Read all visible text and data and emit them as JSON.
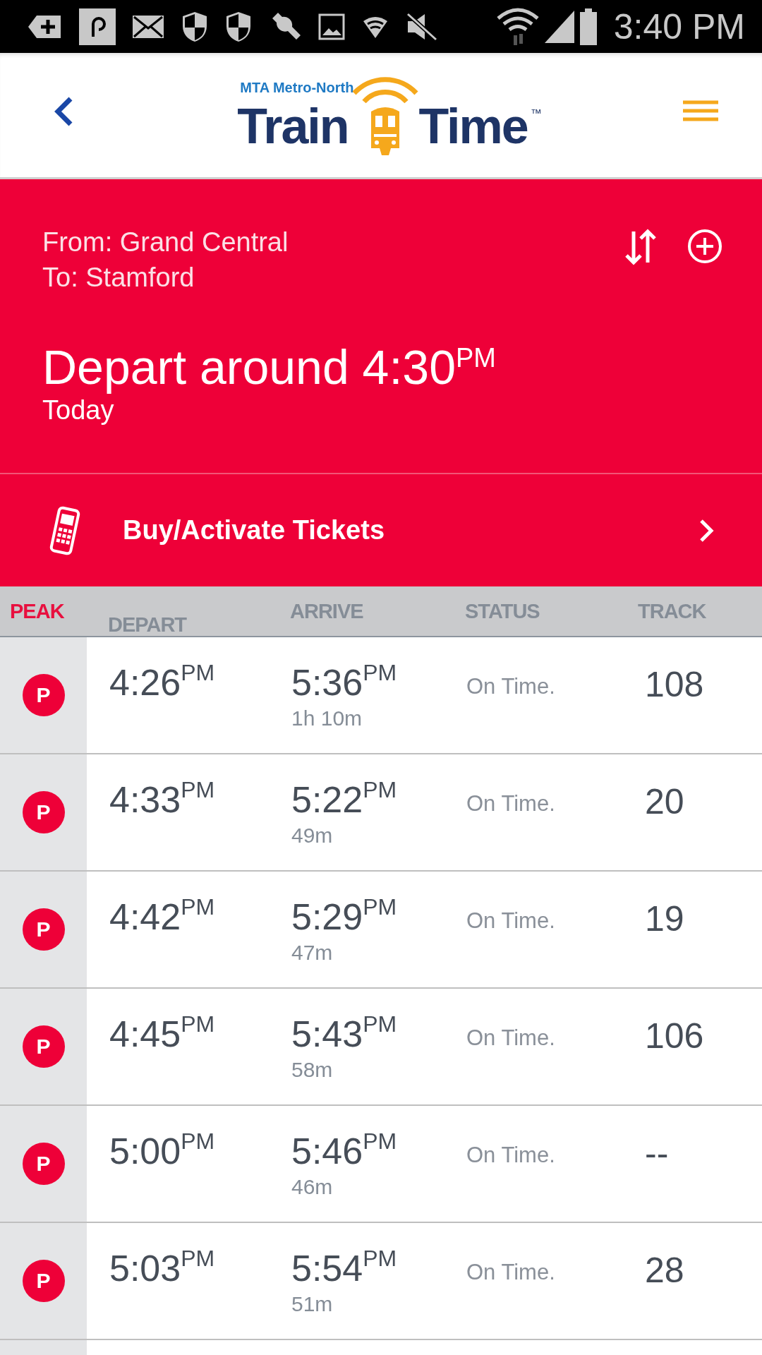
{
  "status_bar": {
    "time": "3:40 PM"
  },
  "header": {
    "brand": "MTA Metro-North",
    "title_left": "Train",
    "title_right": "Time",
    "trademark": "™"
  },
  "trip": {
    "from": "From: Grand Central",
    "to": "To: Stamford",
    "depart": "Depart around 4:30$^{PM}$",
    "day": "Today"
  },
  "tickets": {
    "label": "Buy/Activate Tickets"
  },
  "table": {
    "columns": [
      "PEAK",
      "DEPART",
      "ARRIVE",
      "STATUS",
      "TRACK"
    ],
    "rows": [
      {
        "peak": "P",
        "depart": "4:26$^{PM}$",
        "arrive": "5:36$^{PM}$",
        "duration": "1h 10m",
        "status": "On Time.",
        "track": "108"
      },
      {
        "peak": "P",
        "depart": "4:33$^{PM}$",
        "arrive": "5:22$^{PM}$",
        "duration": "49m",
        "status": "On Time.",
        "track": "20"
      },
      {
        "peak": "P",
        "depart": "4:42$^{PM}$",
        "arrive": "5:29$^{PM}$",
        "duration": "47m",
        "status": "On Time.",
        "track": "19"
      },
      {
        "peak": "P",
        "depart": "4:45$^{PM}$",
        "arrive": "5:43$^{PM}$",
        "duration": "58m",
        "status": "On Time.",
        "track": "106"
      },
      {
        "peak": "P",
        "depart": "5:00$^{PM}$",
        "arrive": "5:46$^{PM}$",
        "duration": "46m",
        "status": "On Time.",
        "track": "--"
      },
      {
        "peak": "P",
        "depart": "5:03$^{PM}$",
        "arrive": "5:54$^{PM}$",
        "duration": "51m",
        "status": "On Time.",
        "track": "28"
      }
    ]
  }
}
